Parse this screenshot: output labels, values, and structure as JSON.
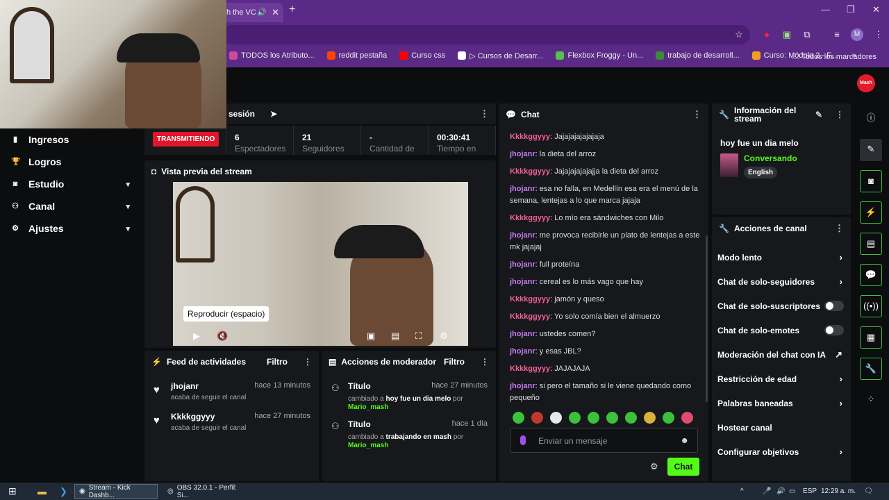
{
  "browser": {
    "tab_title": "h the VC",
    "bookmarks": [
      {
        "label": "TODOS los Atributo...",
        "color": "#cc4b9c"
      },
      {
        "label": "reddit pestaña",
        "color": "#ff4500"
      },
      {
        "label": "Curso css",
        "color": "#ff0000"
      },
      {
        "label": "▷ Cursos de Desarr...",
        "color": "#ffffff"
      },
      {
        "label": "Flexbox Froggy - Un...",
        "color": "#53c14a"
      },
      {
        "label": "trabajo de desarroll...",
        "color": "#3a8b3a"
      },
      {
        "label": "Curso: Módulo 2 - F...",
        "color": "#f0a020"
      }
    ],
    "all_bookmarks": "Todos los marcadores",
    "profile_initial": "M"
  },
  "kick": {
    "logo": "Mash"
  },
  "sidebar": {
    "items": [
      {
        "label": "Ingresos",
        "icon": "ingresos-icon",
        "chevron": false
      },
      {
        "label": "Logros",
        "icon": "trophy-icon",
        "chevron": false
      },
      {
        "label": "Estudio",
        "icon": "studio-icon",
        "chevron": true
      },
      {
        "label": "Canal",
        "icon": "channel-icon",
        "chevron": true
      },
      {
        "label": "Ajustes",
        "icon": "gear-icon",
        "chevron": true
      }
    ]
  },
  "session": {
    "title": "sesión",
    "status": "TRANSMITIENDO",
    "stats": [
      {
        "value": "6",
        "label": "Espectadores"
      },
      {
        "value": "21",
        "label": "Seguidores"
      },
      {
        "value": "-",
        "label": "Cantidad de"
      },
      {
        "value": "00:30:41",
        "label": "Tiempo en"
      }
    ]
  },
  "preview": {
    "title": "Vista previa del stream",
    "tooltip": "Reproducir (espacio)"
  },
  "feed": {
    "title": "Feed de actividades",
    "filter": "Filtro",
    "items": [
      {
        "name": "jhojanr",
        "time": "hace 13 minutos",
        "desc": "acaba de seguir el canal"
      },
      {
        "name": "Kkkkggyyy",
        "time": "hace 27 minutos",
        "desc": "acaba de seguir el canal"
      }
    ]
  },
  "moderator": {
    "title": "Acciones de moderador",
    "filter": "Filtro",
    "items": [
      {
        "title": "Título",
        "time": "hace 27 minutos",
        "prefix": "cambiado a",
        "value": "hoy fue un dia melo",
        "by": "por",
        "user": "Mario_mash"
      },
      {
        "title": "Título",
        "time": "hace 1 día",
        "prefix": "cambiado a",
        "value": "trabajando en mash",
        "by": "por",
        "user": "Mario_mash"
      }
    ]
  },
  "chat": {
    "title": "Chat",
    "placeholder": "Enviar un mensaje",
    "send": "Chat",
    "messages": [
      {
        "user": "Kkkkggyyy",
        "text": "Jajajajajajajaja",
        "color": "#f25f9a"
      },
      {
        "user": "jhojanr",
        "text": "la dieta del arroz",
        "color": "#c57bf2"
      },
      {
        "user": "Kkkkggyyy",
        "text": "Jajajajajajajja la dieta del arroz",
        "color": "#f25f9a"
      },
      {
        "user": "jhojanr",
        "text": "esa no falla, en Medellín esa era el menú de la semana, lentejas a lo que marca jajaja",
        "color": "#c57bf2"
      },
      {
        "user": "Kkkkggyyy",
        "text": "Lo mío era sándwiches con Milo",
        "color": "#f25f9a"
      },
      {
        "user": "jhojanr",
        "text": "me provoca recibirle un plato de lentejas a este mk jajajaj",
        "color": "#c57bf2"
      },
      {
        "user": "jhojanr",
        "text": "full proteína",
        "color": "#c57bf2"
      },
      {
        "user": "jhojanr",
        "text": "cereal es lo más vago que hay",
        "color": "#c57bf2"
      },
      {
        "user": "Kkkkggyyy",
        "text": "jamón y queso",
        "color": "#f25f9a"
      },
      {
        "user": "Kkkkggyyy",
        "text": "Yo solo comía bien el almuerzo",
        "color": "#f25f9a"
      },
      {
        "user": "jhojanr",
        "text": "ustedes comen?",
        "color": "#c57bf2"
      },
      {
        "user": "jhojanr",
        "text": "y esas JBL?",
        "color": "#c57bf2"
      },
      {
        "user": "Kkkkggyyy",
        "text": "JAJAJAJA",
        "color": "#f25f9a"
      },
      {
        "user": "jhojanr",
        "text": "si pero el tamaño si le viene quedando como pequeño",
        "color": "#c57bf2"
      }
    ]
  },
  "stream_info": {
    "title": "Información del stream",
    "stream_title": "hoy fue un dia melo",
    "category": "Conversando",
    "tag": "English"
  },
  "channel_actions": {
    "title": "Acciones de canal",
    "items": [
      {
        "label": "Modo lento",
        "control": "arrow"
      },
      {
        "label": "Chat de solo-seguidores",
        "control": "arrow"
      },
      {
        "label": "Chat de solo-suscriptores",
        "control": "toggle"
      },
      {
        "label": "Chat de solo-emotes",
        "control": "toggle"
      },
      {
        "label": "Moderación del chat con IA",
        "control": "external"
      },
      {
        "label": "Restricción de edad",
        "control": "arrow"
      },
      {
        "label": "Palabras baneadas",
        "control": "arrow"
      },
      {
        "label": "Hostear canal",
        "control": "none"
      },
      {
        "label": "Configurar objetivos",
        "control": "arrow"
      }
    ]
  },
  "taskbar": {
    "apps": [
      {
        "label": "Stream - Kick Dashb..."
      },
      {
        "label": "OBS 32.0.1 - Perfil: Si..."
      }
    ],
    "lang": "ESP",
    "time": "12:29 a. m."
  }
}
